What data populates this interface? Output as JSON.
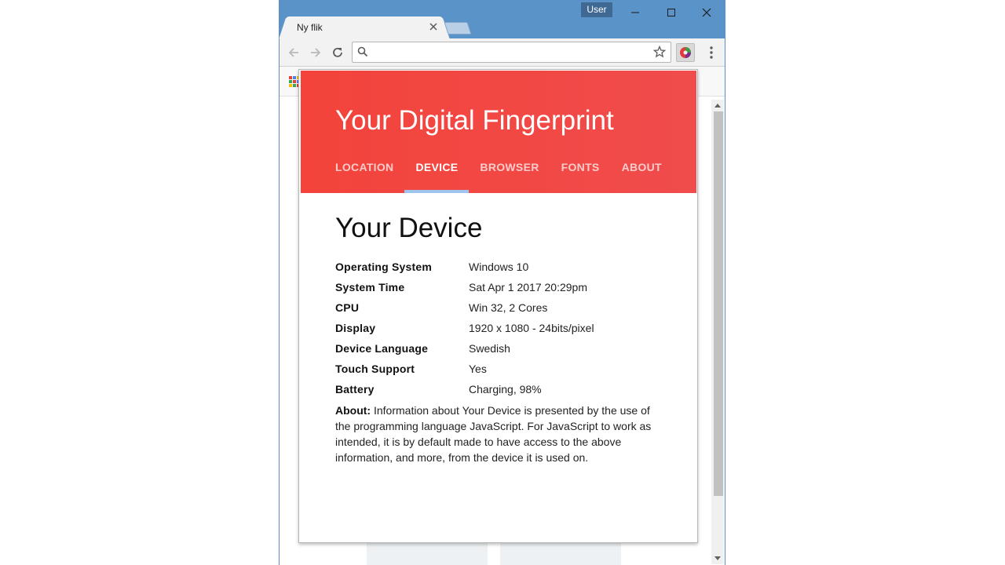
{
  "window": {
    "user_label": "User",
    "tab_title": "Ny flik"
  },
  "omnibox": {
    "value": "",
    "placeholder": ""
  },
  "popup": {
    "header_title": "Your Digital Fingerprint",
    "tabs": [
      {
        "label": "LOCATION",
        "active": false
      },
      {
        "label": "DEVICE",
        "active": true
      },
      {
        "label": "BROWSER",
        "active": false
      },
      {
        "label": "FONTS",
        "active": false
      },
      {
        "label": "ABOUT",
        "active": false
      }
    ],
    "section_heading": "Your Device",
    "rows": [
      {
        "label": "Operating System",
        "value": "Windows 10"
      },
      {
        "label": "System Time",
        "value": "Sat Apr 1 2017 20:29pm"
      },
      {
        "label": "CPU",
        "value": "Win 32, 2 Cores"
      },
      {
        "label": "Display",
        "value": "1920 x 1080 - 24bits/pixel"
      },
      {
        "label": "Device Language",
        "value": "Swedish"
      },
      {
        "label": "Touch Support",
        "value": "Yes"
      },
      {
        "label": "Battery",
        "value": "Charging, 98%"
      }
    ],
    "about_label": "About:",
    "about_text": " Information about Your Device is presented by the use of the programming language JavaScript. For JavaScript to work as intended, it is by default made to have access to the above information, and more, from the device it is used on."
  },
  "colors": {
    "titlebar": "#5a93c8",
    "header_red": "#f3433b",
    "tab_underline": "#9ec5ee"
  },
  "icons": {
    "back": "arrow-left-icon",
    "forward": "arrow-right-icon",
    "reload": "reload-icon",
    "search": "search-icon",
    "star": "star-icon",
    "extension": "fingerprint-extension-icon",
    "menu": "more-vert-icon",
    "apps": "apps-grid-icon"
  }
}
